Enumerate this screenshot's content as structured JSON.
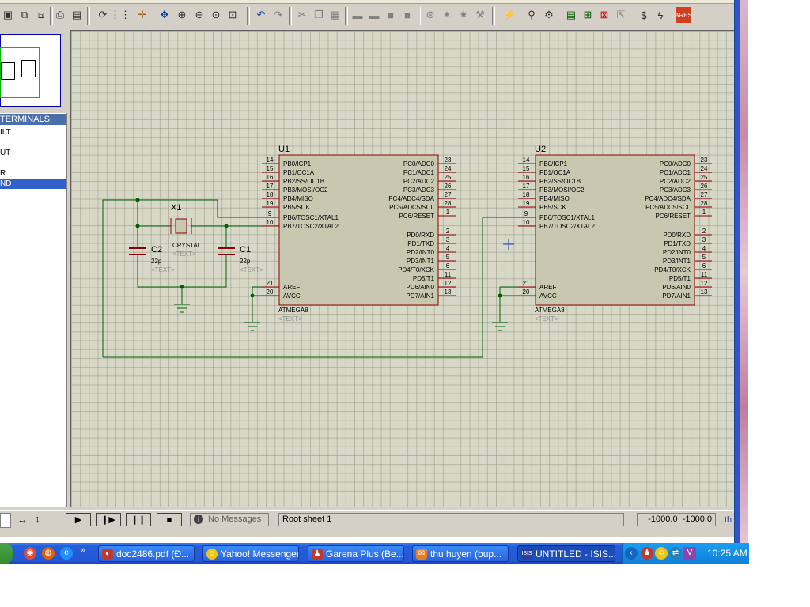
{
  "left_panel": {
    "header": "TERMINALS",
    "items": [
      "ILT",
      "UT",
      "R",
      "ND"
    ],
    "selected_index": 3
  },
  "schematic": {
    "u1": {
      "ref": "U1",
      "part": "ATMEGA8",
      "text": "<TEXT>",
      "left_pins": [
        {
          "num": "14",
          "name": "PB0/ICP1"
        },
        {
          "num": "15",
          "name": "PB1/OC1A"
        },
        {
          "num": "16",
          "name": "PB2/SS/OC1B"
        },
        {
          "num": "17",
          "name": "PB3/MOSI/OC2"
        },
        {
          "num": "18",
          "name": "PB4/MISO"
        },
        {
          "num": "19",
          "name": "PB5/SCK"
        },
        {
          "num": "9",
          "name": "PB6/TOSC1/XTAL1"
        },
        {
          "num": "10",
          "name": "PB7/TOSC2/XTAL2"
        },
        {
          "num": "21",
          "name": "AREF"
        },
        {
          "num": "20",
          "name": "AVCC"
        }
      ],
      "right_pins": [
        {
          "num": "23",
          "name": "PC0/ADC0"
        },
        {
          "num": "24",
          "name": "PC1/ADC1"
        },
        {
          "num": "25",
          "name": "PC2/ADC2"
        },
        {
          "num": "26",
          "name": "PC3/ADC3"
        },
        {
          "num": "27",
          "name": "PC4/ADC4/SDA"
        },
        {
          "num": "28",
          "name": "PC5/ADC5/SCL"
        },
        {
          "num": "1",
          "name": "PC6/RESET"
        },
        {
          "num": "2",
          "name": "PD0/RXD"
        },
        {
          "num": "3",
          "name": "PD1/TXD"
        },
        {
          "num": "4",
          "name": "PD2/INT0"
        },
        {
          "num": "5",
          "name": "PD3/INT1"
        },
        {
          "num": "6",
          "name": "PD4/T0/XCK"
        },
        {
          "num": "11",
          "name": "PD5/T1"
        },
        {
          "num": "12",
          "name": "PD6/AIN0"
        },
        {
          "num": "13",
          "name": "PD7/AIN1"
        }
      ]
    },
    "u2": {
      "ref": "U2",
      "part": "ATMEGA8",
      "text": "<TEXT>"
    },
    "x1": {
      "ref": "X1",
      "value": "CRYSTAL",
      "text": "<TEXT>"
    },
    "c1": {
      "ref": "C1",
      "value": "22p",
      "text": "<TEXT>"
    },
    "c2": {
      "ref": "C2",
      "value": "22p",
      "text": "<TEXT>"
    }
  },
  "status": {
    "messages": "No Messages",
    "sheet": "Root sheet 1",
    "coord_x": "-1000.0",
    "coord_y": "-1000.0",
    "units": "th"
  },
  "taskbar": {
    "buttons": [
      {
        "label": "doc2486.pdf (Đ...",
        "icon": "pdf-icon",
        "color": "#c0392b"
      },
      {
        "label": "Yahoo! Messenger",
        "icon": "yahoo-smiley-icon",
        "color": "#f1c40f"
      },
      {
        "label": "Garena Plus (Be...",
        "icon": "garena-icon",
        "color": "#c0392b"
      },
      {
        "label": "thu huyen (bup...",
        "icon": "chat-icon",
        "color": "#e67e22"
      },
      {
        "label": "UNTITLED - ISIS...",
        "icon": "isis-icon",
        "color": "#2c3e9c"
      }
    ],
    "clock": "10:25 AM"
  },
  "colors": {
    "sheet_bg": "#d8d8c8",
    "chip_fill": "#c8c8b0",
    "chip_border": "#8b0000",
    "wire": "#006000",
    "pin_text": "#000000",
    "placeholder_text": "#909090"
  }
}
